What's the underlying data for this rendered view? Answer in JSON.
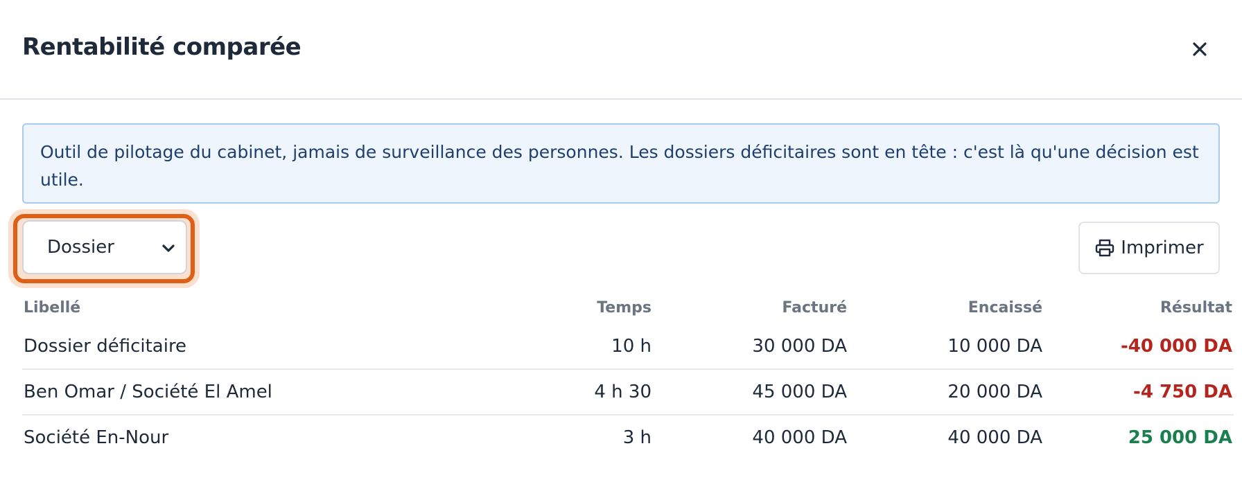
{
  "modal": {
    "title": "Rentabilité comparée"
  },
  "info": {
    "text": "Outil de pilotage du cabinet, jamais de surveillance des personnes. Les dossiers déficitaires sont en tête : c'est là qu'une décision est utile."
  },
  "toolbar": {
    "group_select_value": "Dossier",
    "print_label": "Imprimer"
  },
  "table": {
    "headers": {
      "label": "Libellé",
      "time": "Temps",
      "billed": "Facturé",
      "collected": "Encaissé",
      "result": "Résultat"
    },
    "rows": [
      {
        "label": "Dossier déficitaire",
        "time": "10 h",
        "billed": "30 000 DA",
        "collected": "10 000 DA",
        "result": "-40 000 DA",
        "status": "negative"
      },
      {
        "label": "Ben Omar / Société El Amel",
        "time": "4 h 30",
        "billed": "45 000 DA",
        "collected": "20 000 DA",
        "result": "-4 750 DA",
        "status": "negative"
      },
      {
        "label": "Société En-Nour",
        "time": "3 h",
        "billed": "40 000 DA",
        "collected": "40 000 DA",
        "result": "25 000 DA",
        "status": "positive"
      }
    ]
  },
  "colors": {
    "negative": "#b3261e",
    "positive": "#1a7f4e",
    "focus_outline": "#e05f16",
    "info_background": "#eef5fd",
    "info_border": "#a7ccef"
  }
}
